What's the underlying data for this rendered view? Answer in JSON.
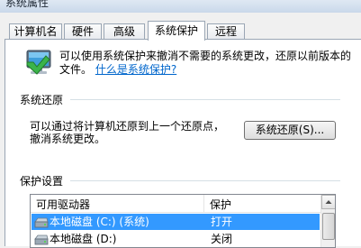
{
  "window": {
    "title": "系统属性"
  },
  "tabs": [
    {
      "label": "计算机名",
      "active": false
    },
    {
      "label": "硬件",
      "active": false
    },
    {
      "label": "高级",
      "active": false
    },
    {
      "label": "系统保护",
      "active": true
    },
    {
      "label": "远程",
      "active": false
    }
  ],
  "intro": {
    "text": "可以使用系统保护来撤消不需要的系统更改，还原以前版本的文件。",
    "link": "什么是系统保护?"
  },
  "system_restore": {
    "title": "系统还原",
    "description_line1": "可以通过将计算机还原到上一个还原点，",
    "description_line2": "撤消系统更改。",
    "button_label": "系统还原(S)..."
  },
  "protection_settings": {
    "title": "保护设置",
    "columns": [
      "可用驱动器",
      "保护"
    ],
    "rows": [
      {
        "drive": "本地磁盘 (C:) (系统)",
        "protection": "打开",
        "selected": true
      },
      {
        "drive": "本地磁盘 (D:)",
        "protection": "关闭",
        "selected": false
      }
    ]
  },
  "colors": {
    "selection": "#3399ff",
    "link": "#0066cc",
    "panel": "#ffffff",
    "background": "#f0f0f0"
  },
  "icons": [
    "system-protection-icon",
    "drive-icon",
    "scroll-up-arrow-icon"
  ]
}
